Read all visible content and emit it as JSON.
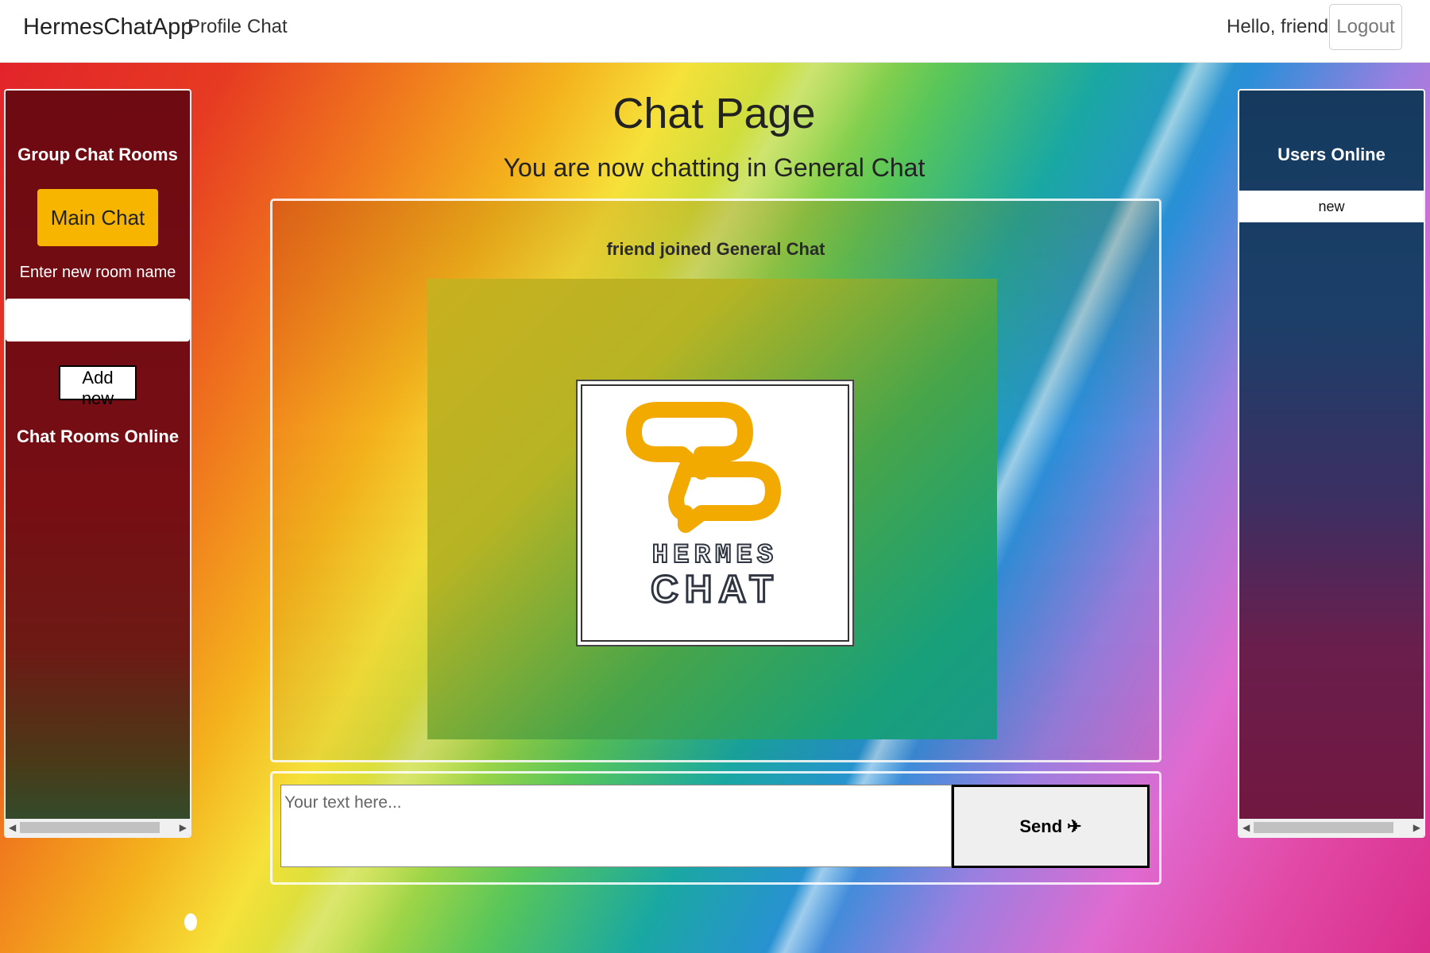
{
  "navbar": {
    "brand": "HermesChatApp",
    "links": [
      "Profile",
      "Chat"
    ],
    "greeting": "Hello, friend",
    "logout_label": "Logout"
  },
  "left_panel": {
    "title": "Group Chat Rooms",
    "main_chat_label": "Main Chat",
    "enter_room_label": "Enter new room name",
    "room_input_value": "",
    "add_button_label": "Add new",
    "rooms_online_title": "Chat Rooms Online"
  },
  "right_panel": {
    "title": "Users Online",
    "users": [
      "new"
    ]
  },
  "main": {
    "title": "Chat Page",
    "subtitle": "You are now chatting in General Chat",
    "join_message": "friend joined General Chat",
    "logo_text_line1": "HERMES",
    "logo_text_line2": "CHAT",
    "input_placeholder": "Your text here...",
    "send_label": "Send",
    "send_icon": "paper-plane-icon"
  },
  "colors": {
    "accent_button": "#f7b500",
    "logo_orange": "#f2a900",
    "logo_text": "#2e3440"
  }
}
